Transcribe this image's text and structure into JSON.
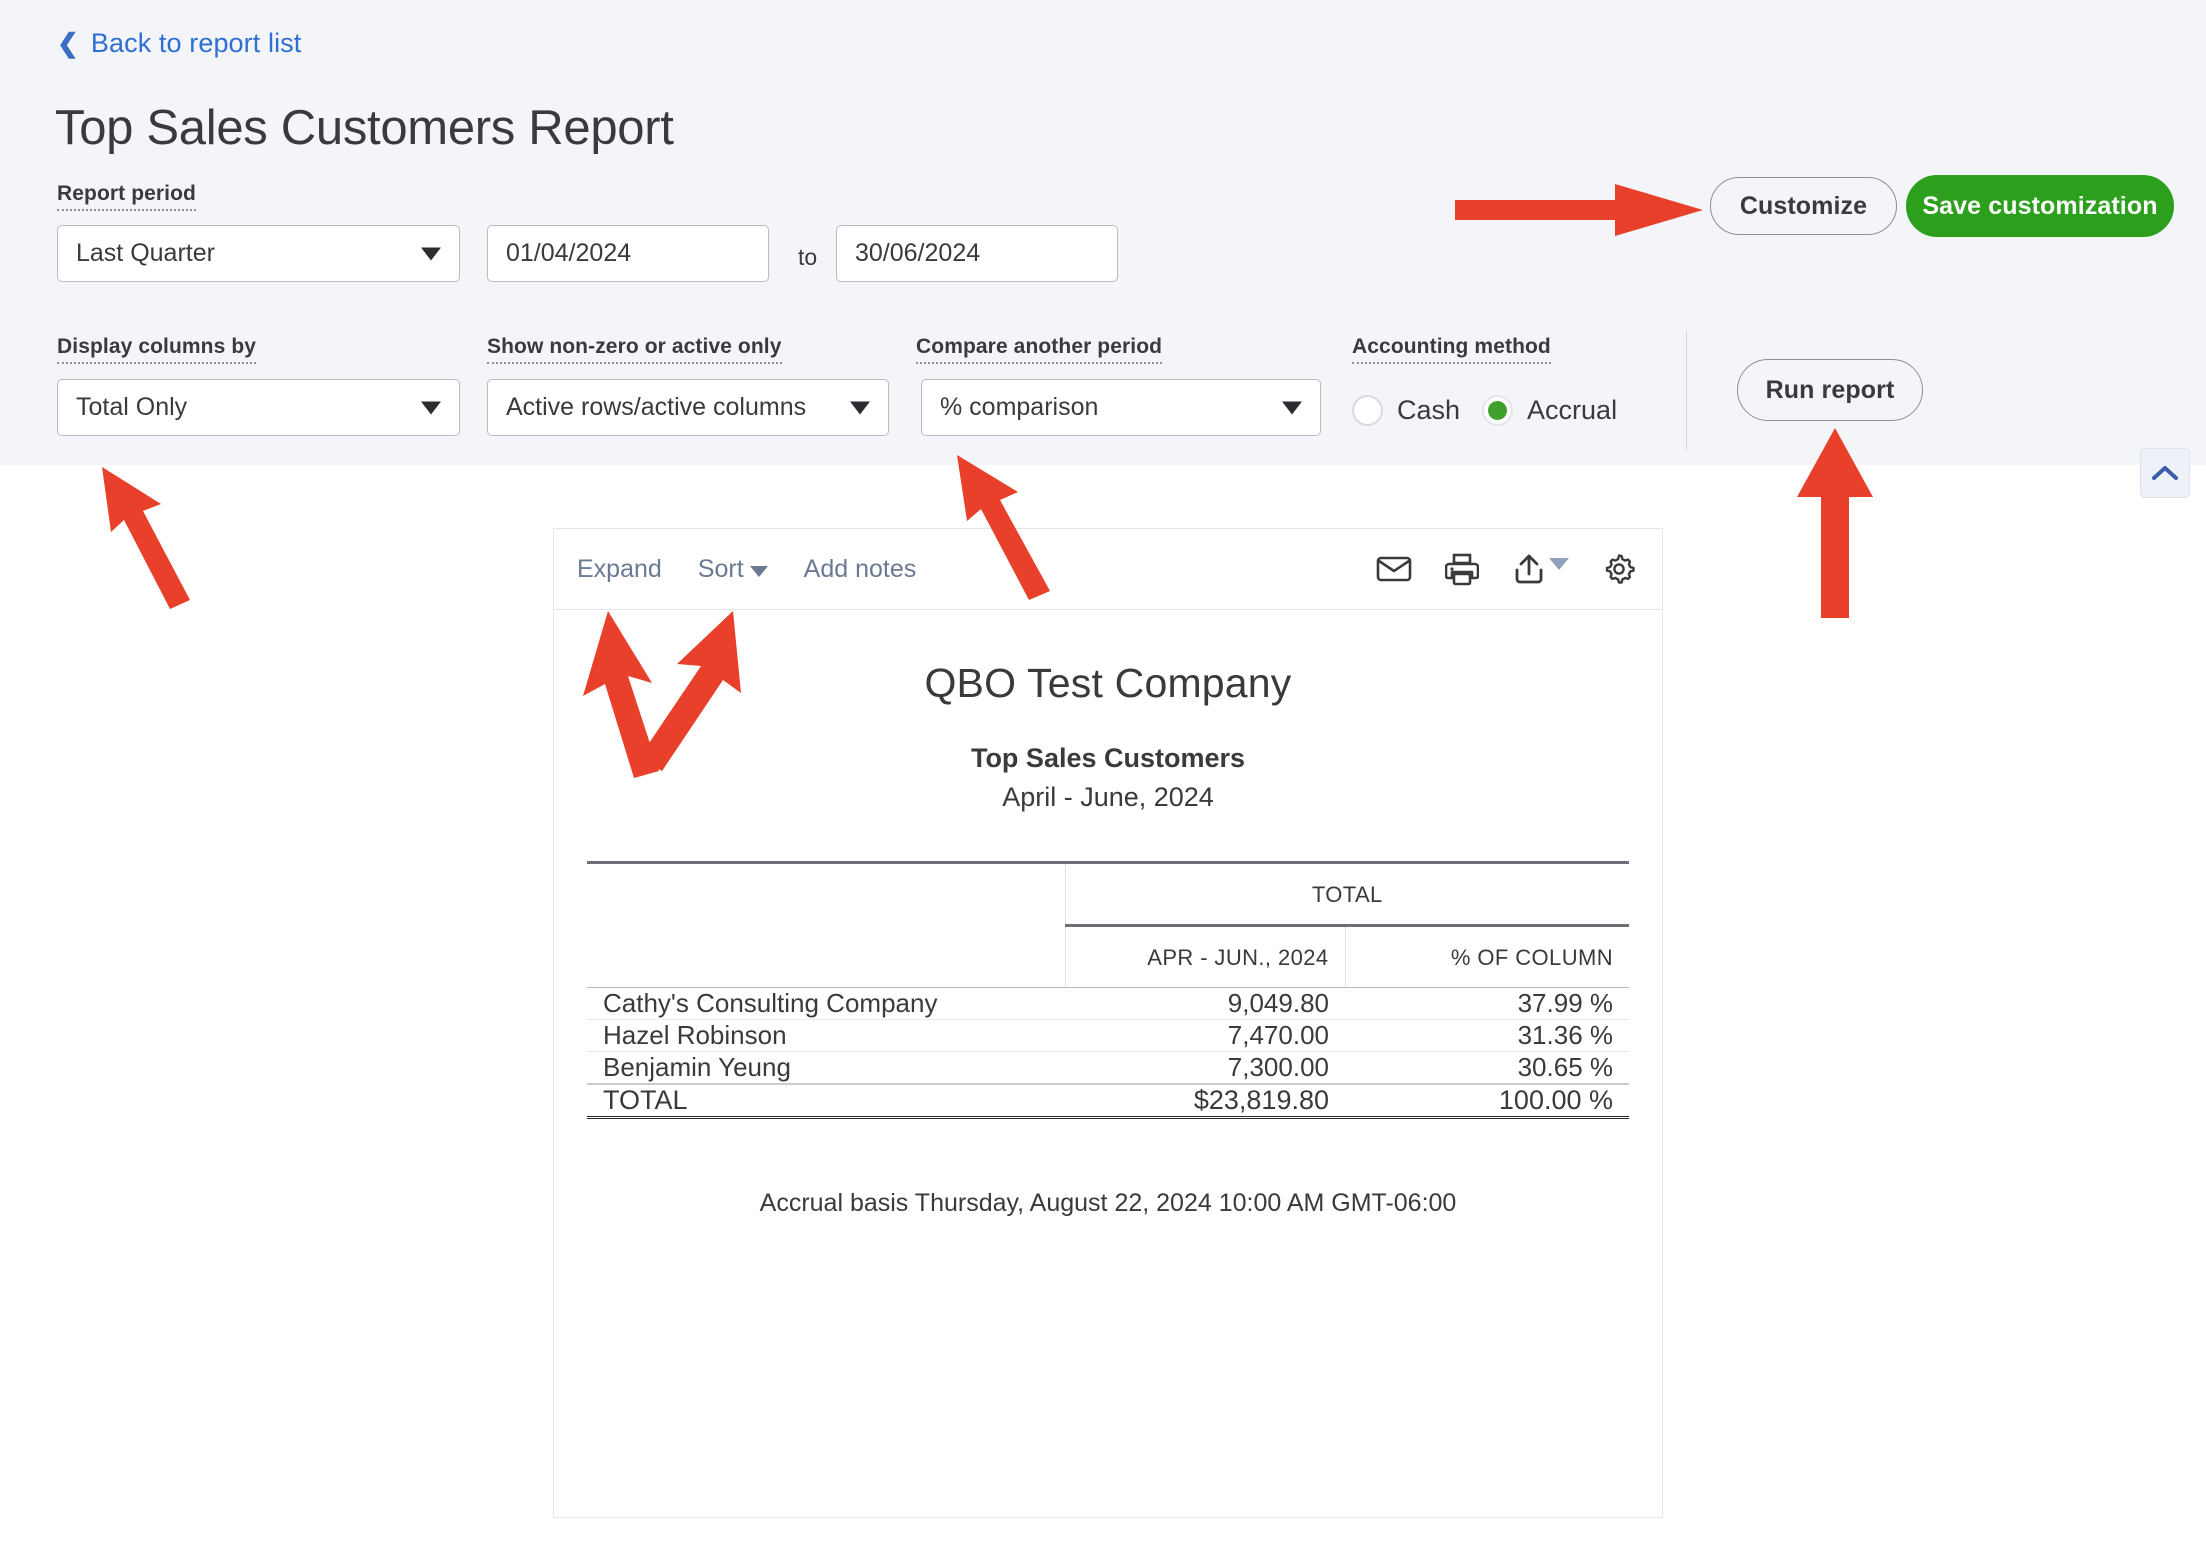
{
  "header": {
    "back_link": "Back to report list",
    "back_icon": "chevron-left-icon",
    "title": "Top Sales Customers Report"
  },
  "filters": {
    "report_period": {
      "label": "Report period",
      "value": "Last Quarter",
      "caret_icon": "chevron-down-icon"
    },
    "date_from": {
      "value": "01/04/2024"
    },
    "date_to": {
      "value": "30/06/2024"
    },
    "to_word": "to",
    "display_columns_by": {
      "label": "Display columns by",
      "value": "Total Only",
      "caret_icon": "chevron-down-icon"
    },
    "show_non_zero": {
      "label": "Show non-zero or active only",
      "value": "Active rows/active columns",
      "caret_icon": "chevron-down-icon"
    },
    "compare_period": {
      "label": "Compare another period",
      "value": "% comparison",
      "caret_icon": "chevron-down-icon"
    },
    "accounting_method": {
      "label": "Accounting method",
      "options": [
        "Cash",
        "Accrual"
      ],
      "selected": "Accrual",
      "selected_color": "#3fa12b"
    }
  },
  "actions": {
    "customize": "Customize",
    "save_customization": "Save customization",
    "save_customization_color": "#2ca01c",
    "run_report": "Run report",
    "collapse_icon": "chevron-up-icon"
  },
  "report_toolbar": {
    "expand": "Expand",
    "sort": "Sort",
    "sort_caret_icon": "chevron-down-icon",
    "add_notes": "Add notes",
    "icons": [
      "email-icon",
      "print-icon",
      "export-icon",
      "gear-icon"
    ]
  },
  "report": {
    "company": "QBO Test Company",
    "name": "Top Sales Customers",
    "date_range": "April - June, 2024",
    "group_header": "TOTAL",
    "columns": [
      "",
      "APR - JUN., 2024",
      "% OF COLUMN"
    ],
    "rows": [
      {
        "name": "Cathy's Consulting Company",
        "amount": "9,049.80",
        "percent": "37.99 %"
      },
      {
        "name": "Hazel Robinson",
        "amount": "7,470.00",
        "percent": "31.36 %"
      },
      {
        "name": "Benjamin Yeung",
        "amount": "7,300.00",
        "percent": "30.65 %"
      }
    ],
    "total_row": {
      "name": "TOTAL",
      "amount": "$23,819.80",
      "percent": "100.00 %"
    },
    "footer": "Accrual basis  Thursday, August 22, 2024  10:00 AM GMT-06:00"
  },
  "annotations": {
    "arrow_color": "#e8402a",
    "arrows": [
      "arrow-to-customize-button",
      "arrow-to-display-columns-by",
      "arrow-to-compare-another-period",
      "arrow-to-run-report-button",
      "arrow-to-expand-link",
      "arrow-to-sort-link"
    ]
  }
}
